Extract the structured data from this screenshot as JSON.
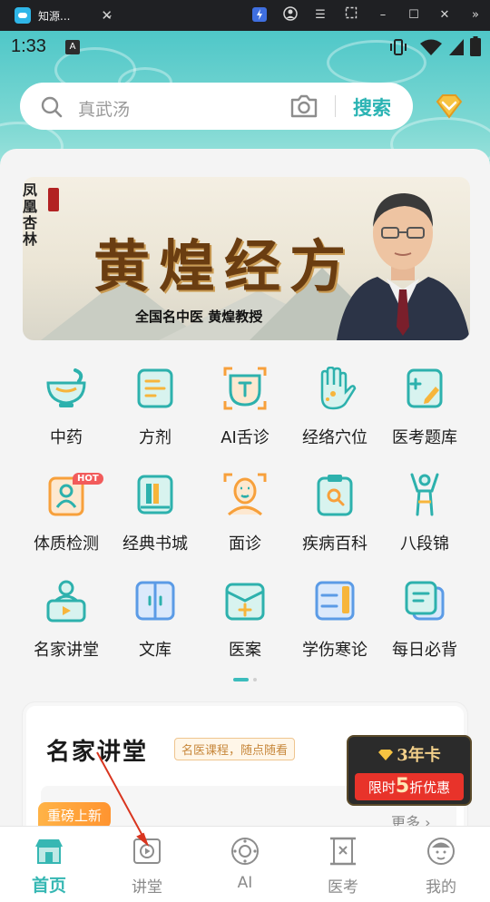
{
  "window": {
    "tab_title": "知源...",
    "close_glyph": "✕",
    "dropdown_glyph": "⌄",
    "menu_glyph": "☰",
    "minimize_glyph": "–",
    "maximize_glyph": "☐",
    "window_close_glyph": "✕",
    "expand_glyph": "»"
  },
  "status_bar": {
    "time": "1:33",
    "notification_letter": "A"
  },
  "search": {
    "placeholder": "真武汤",
    "button_label": "搜索"
  },
  "banner": {
    "brand": "凤凰杏林",
    "title": "黄煌经方",
    "subtitle": "全国名中医  黄煌教授"
  },
  "grid_items": [
    {
      "label": "中药",
      "icon": "herb-bowl-icon"
    },
    {
      "label": "方剂",
      "icon": "prescription-icon"
    },
    {
      "label": "AI舌诊",
      "icon": "tongue-scan-icon"
    },
    {
      "label": "经络穴位",
      "icon": "hand-acupoint-icon"
    },
    {
      "label": "医考题库",
      "icon": "exam-book-icon"
    },
    {
      "label": "体质检测",
      "icon": "constitution-test-icon"
    },
    {
      "label": "经典书城",
      "icon": "bookstore-icon"
    },
    {
      "label": "面诊",
      "icon": "face-diagnosis-icon"
    },
    {
      "label": "疾病百科",
      "icon": "disease-encyclopedia-icon"
    },
    {
      "label": "八段锦",
      "icon": "baduanjin-icon"
    },
    {
      "label": "名家讲堂",
      "icon": "lecture-icon"
    },
    {
      "label": "文库",
      "icon": "library-icon"
    },
    {
      "label": "医案",
      "icon": "medical-case-icon"
    },
    {
      "label": "学伤寒论",
      "icon": "shanghan-icon"
    },
    {
      "label": "每日必背",
      "icon": "daily-memo-icon"
    }
  ],
  "hot_badge": "HOT",
  "lecture_section": {
    "title": "名家讲堂",
    "tag": "名医课程，随点随看",
    "new_label": "重磅上新",
    "more_label": "更多 ›"
  },
  "promo": {
    "card_label": "3年卡",
    "prefix": "限时",
    "discount": "5",
    "suffix": "折优惠"
  },
  "bottom_nav": [
    {
      "label": "首页",
      "icon": "home-icon",
      "active": true
    },
    {
      "label": "讲堂",
      "icon": "lecture-play-icon",
      "active": false
    },
    {
      "label": "AI",
      "icon": "ai-icon",
      "active": false
    },
    {
      "label": "医考",
      "icon": "exam-scroll-icon",
      "active": false
    },
    {
      "label": "我的",
      "icon": "profile-icon",
      "active": false
    }
  ],
  "colors": {
    "accent": "#36b7b3",
    "header_gradient_top": "#4fc7c8",
    "promo_red": "#e8332a",
    "arrow": "#d9351f"
  }
}
